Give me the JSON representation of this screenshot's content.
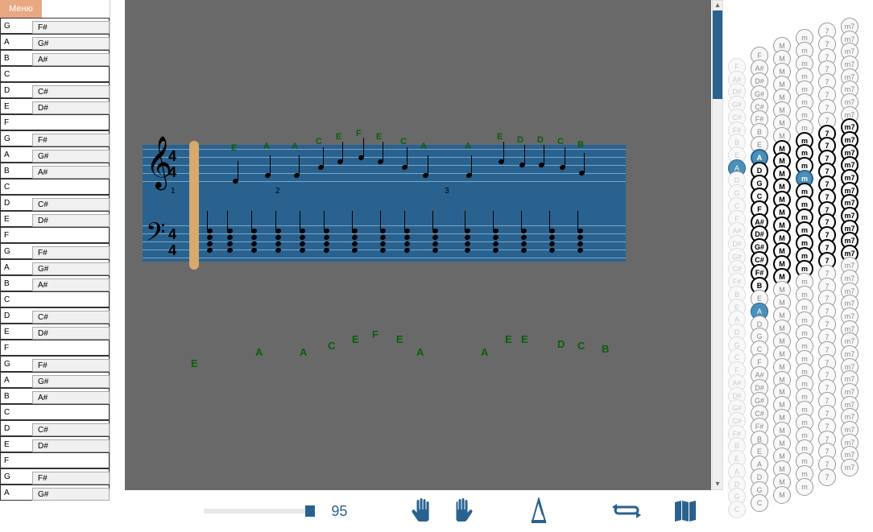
{
  "menu": {
    "label": "Меню"
  },
  "piano": {
    "white_keys": [
      "G",
      "A",
      "B",
      "C",
      "D",
      "E",
      "F",
      "G",
      "A",
      "B",
      "C",
      "D",
      "E",
      "F",
      "G",
      "A",
      "B",
      "C",
      "D",
      "E",
      "F",
      "G",
      "A",
      "B",
      "C",
      "D",
      "E",
      "F",
      "G",
      "A"
    ],
    "black_keys": [
      "F#",
      "G#",
      "A#",
      "C#",
      "D#",
      "F#",
      "G#",
      "A#",
      "C#",
      "D#",
      "F#",
      "G#",
      "A#",
      "C#",
      "D#",
      "F#",
      "G#",
      "A#",
      "C#",
      "D#",
      "F#",
      "G#"
    ]
  },
  "score": {
    "timesig_top": "4",
    "timesig_bot": "4",
    "bar_numbers": [
      "1",
      "2",
      "3"
    ],
    "melody_letters": [
      "E",
      "A",
      "A",
      "C",
      "E",
      "F",
      "E",
      "C",
      "A",
      "A",
      "E",
      "D",
      "D",
      "C",
      "B"
    ],
    "melody_letters_large": [
      "E",
      "A",
      "A",
      "C",
      "E",
      "F",
      "E",
      "A",
      "A",
      "E",
      "E",
      "D",
      "C",
      "B"
    ]
  },
  "toolbar": {
    "tempo": "95"
  },
  "accordion": {
    "row_labels": [
      "F",
      "A#",
      "D#",
      "G#",
      "C#",
      "F#",
      "B",
      "E",
      "A",
      "D",
      "G",
      "C",
      "F",
      "A#",
      "D#",
      "G#",
      "C#",
      "F#",
      "B",
      "E",
      "A",
      "D",
      "G",
      "C",
      "F",
      "A#",
      "D#",
      "G#",
      "C#",
      "F#",
      "B",
      "E",
      "A",
      "D",
      "G",
      "C"
    ],
    "highlighted_root": "A",
    "col_types": [
      "",
      "",
      "M",
      "m",
      "7",
      "m7"
    ]
  }
}
